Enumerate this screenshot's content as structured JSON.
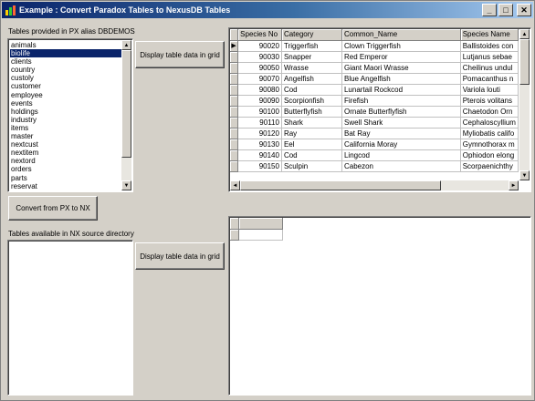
{
  "window": {
    "title": "Example : Convert Paradox Tables to NexusDB Tables",
    "min_glyph": "_",
    "max_glyph": "□",
    "close_glyph": "✕"
  },
  "px_section": {
    "label": "Tables provided in PX alias DBDEMOS",
    "tables": [
      "animals",
      "biolife",
      "clients",
      "country",
      "custoly",
      "customer",
      "employee",
      "events",
      "holdings",
      "industry",
      "items",
      "master",
      "nextcust",
      "nextitem",
      "nextord",
      "orders",
      "parts",
      "reservat"
    ],
    "selected": "biolife",
    "display_button": "Display table data in grid",
    "convert_button": "Convert from PX to NX"
  },
  "nx_section": {
    "label": "Tables available in NX source directory",
    "tables": [],
    "display_button": "Display table data in grid"
  },
  "grid_top": {
    "columns": [
      "Species No",
      "Category",
      "Common_Name",
      "Species Name"
    ],
    "rows": [
      [
        "90020",
        "Triggerfish",
        "Clown Triggerfish",
        "Ballistoides con"
      ],
      [
        "90030",
        "Snapper",
        "Red Emperor",
        "Lutjanus sebae"
      ],
      [
        "90050",
        "Wrasse",
        "Giant Maori Wrasse",
        "Cheilinus undul"
      ],
      [
        "90070",
        "Angelfish",
        "Blue Angelfish",
        "Pomacanthus n"
      ],
      [
        "90080",
        "Cod",
        "Lunartail Rockcod",
        "Variola louti"
      ],
      [
        "90090",
        "Scorpionfish",
        "Firefish",
        "Pterois volitans"
      ],
      [
        "90100",
        "Butterflyfish",
        "Ornate Butterflyfish",
        "Chaetodon Orn"
      ],
      [
        "90110",
        "Shark",
        "Swell Shark",
        "Cephaloscyllium"
      ],
      [
        "90120",
        "Ray",
        "Bat Ray",
        "Myliobatis califo"
      ],
      [
        "90130",
        "Eel",
        "California Moray",
        "Gymnothorax m"
      ],
      [
        "90140",
        "Cod",
        "Lingcod",
        "Ophiodon elong"
      ],
      [
        "90150",
        "Sculpin",
        "Cabezon",
        "Scorpaenichthy"
      ]
    ],
    "current_row_indicator": "▶"
  },
  "icons": {
    "app": "app-icon",
    "scroll_up": "▲",
    "scroll_down": "▼",
    "scroll_left": "◄",
    "scroll_right": "►"
  }
}
